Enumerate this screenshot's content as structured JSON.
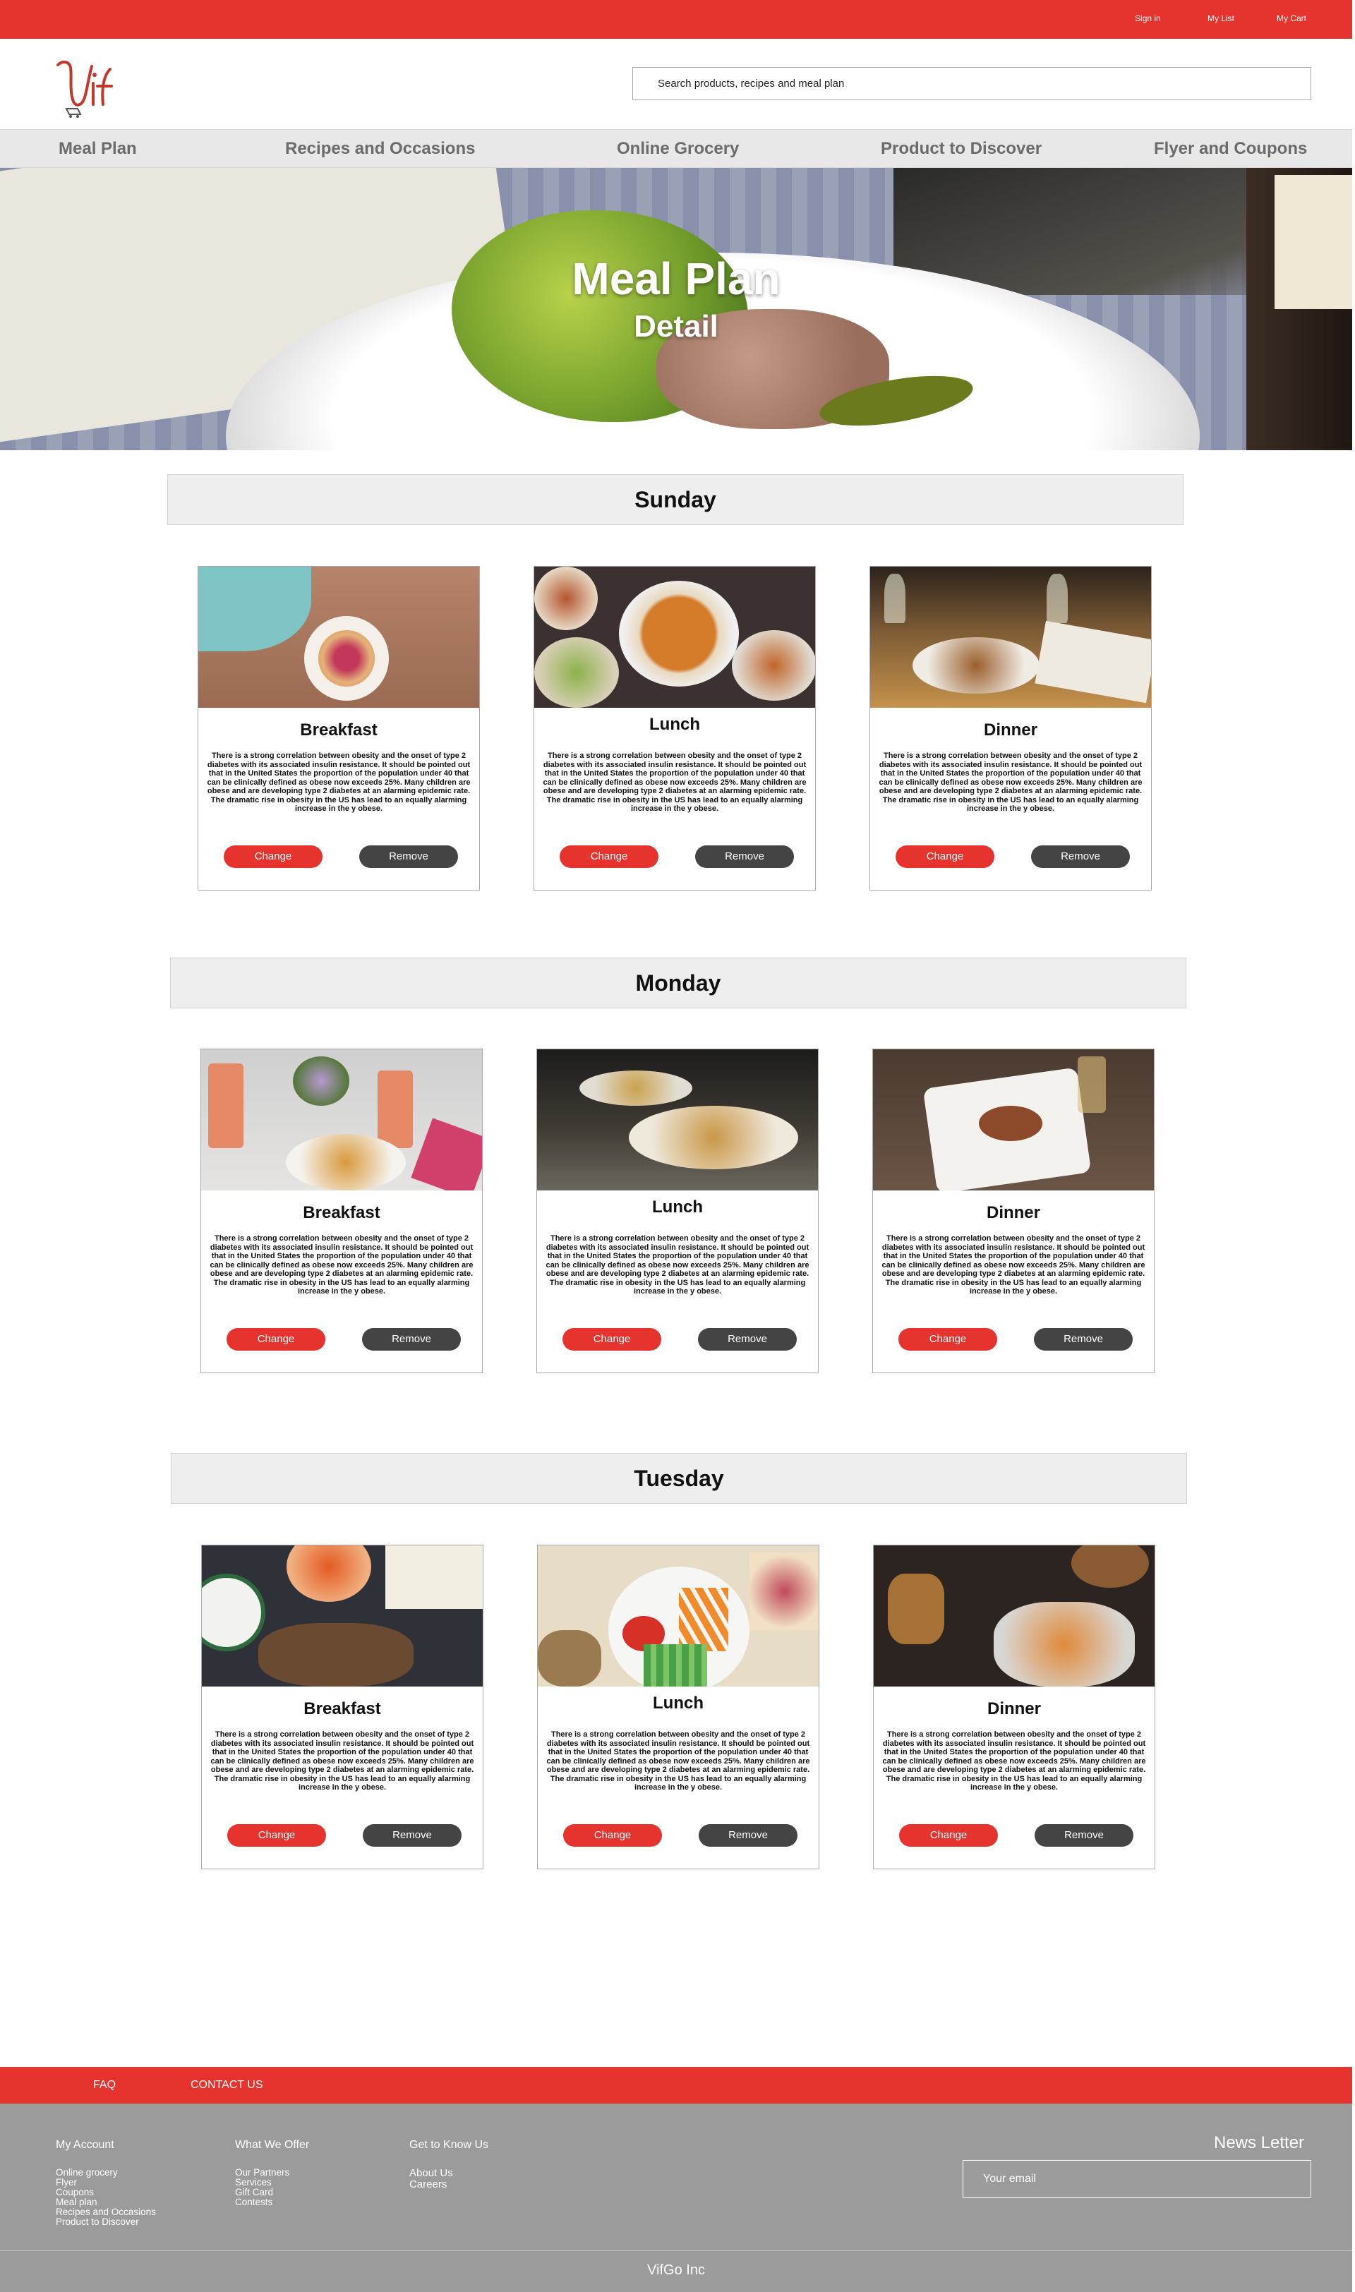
{
  "topbar": {
    "sign_in": "Sign in",
    "my_list": "My List",
    "my_cart": "My Cart"
  },
  "search": {
    "placeholder": "Search products, recipes and meal plan"
  },
  "nav": {
    "items": [
      "Meal Plan",
      "Recipes and Occasions",
      "Online Grocery",
      "Product to Discover",
      "Flyer and Coupons"
    ]
  },
  "hero": {
    "title": "Meal Plan",
    "subtitle": "Detail"
  },
  "meal_description": "There is a strong correlation between obesity and the onset of type 2 diabetes with its associated insulin resistance. It should be pointed out that in the United States the proportion of the population under 40 that can be clinically defined as obese now exceeds 25%. Many children are obese and are developing type 2 diabetes at an alarming epidemic rate. The dramatic rise in obesity in the US has lead to an equally alarming increase in the y obese.",
  "days": [
    {
      "name": "Sunday",
      "meals": [
        "Breakfast",
        "Lunch",
        "Dinner"
      ]
    },
    {
      "name": "Monday",
      "meals": [
        "Breakfast",
        "Lunch",
        "Dinner"
      ]
    },
    {
      "name": "Tuesday",
      "meals": [
        "Breakfast",
        "Lunch",
        "Dinner"
      ]
    }
  ],
  "buttons": {
    "change": "Change",
    "remove": "Remove"
  },
  "footer_bar": {
    "faq": "FAQ",
    "contact": "CONTACT US"
  },
  "footer": {
    "my_account": {
      "heading": "My Account",
      "links": [
        "Online grocery",
        "Flyer",
        "Coupons",
        "Meal plan",
        "Recipes and Occasions",
        "Product to Discover"
      ]
    },
    "what_we_offer": {
      "heading": "What We Offer",
      "links": [
        "Our Partners",
        "Services",
        "Gift Card",
        "Contests"
      ]
    },
    "get_to_know": {
      "heading": "Get to Know  Us",
      "links": [
        "About Us",
        "Careers"
      ]
    },
    "newsletter": {
      "heading": "News Letter",
      "placeholder": "Your email"
    },
    "copyright": "VifGo Inc"
  },
  "colors": {
    "brand_red": "#e6332e",
    "remove_button": "#444444",
    "footer_gray": "#9b9b9b"
  }
}
